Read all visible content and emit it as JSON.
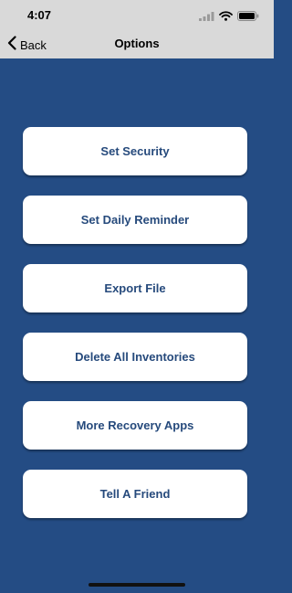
{
  "status_bar": {
    "time": "4:07",
    "icons": [
      "signal-icon",
      "wifi-icon",
      "battery-icon"
    ]
  },
  "nav": {
    "back_label": "Back",
    "title": "Options"
  },
  "menu": {
    "items": [
      {
        "label": "Set Security"
      },
      {
        "label": "Set Daily Reminder"
      },
      {
        "label": "Export File"
      },
      {
        "label": "Delete All Inventories"
      },
      {
        "label": "More Recovery Apps"
      },
      {
        "label": "Tell A Friend"
      }
    ]
  },
  "colors": {
    "background": "#244c84",
    "nav_background": "#d9d9d9",
    "button_text": "#264a7c",
    "button_background": "#ffffff"
  }
}
